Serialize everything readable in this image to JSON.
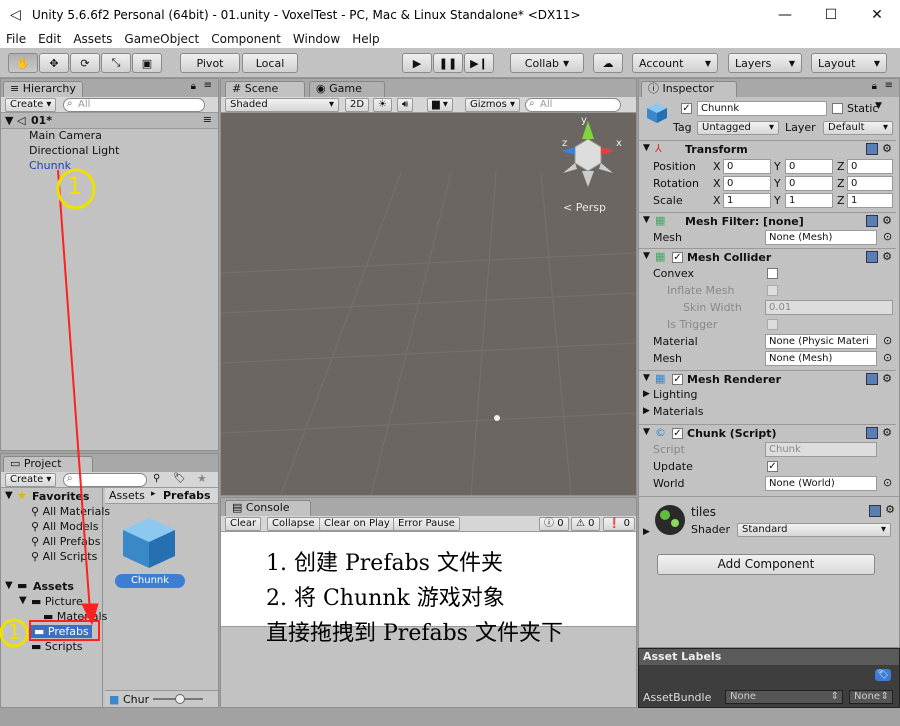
{
  "window": {
    "title": "Unity 5.6.6f2 Personal (64bit) - 01.unity - VoxelTest - PC, Mac & Linux Standalone* <DX11>",
    "minimize": "—",
    "maximize": "☐",
    "close": "✕"
  },
  "menu": [
    "File",
    "Edit",
    "Assets",
    "GameObject",
    "Component",
    "Window",
    "Help"
  ],
  "toolbar": {
    "pivot": "Pivot",
    "local": "Local",
    "collab": "Collab",
    "account": "Account",
    "layers": "Layers",
    "layout": "Layout"
  },
  "hierarchy": {
    "tab": "Hierarchy",
    "create": "Create",
    "search_placeholder": "All",
    "scene": "01*",
    "items": [
      "Main Camera",
      "Directional Light",
      "Chunnk"
    ]
  },
  "scene": {
    "tab_scene": "Scene",
    "tab_game": "Game",
    "shading": "Shaded",
    "mode2d": "2D",
    "gizmos": "Gizmos",
    "search_placeholder": "All",
    "persp": "Persp",
    "gizmo_axes": [
      "y",
      "x",
      "z"
    ]
  },
  "project": {
    "tab": "Project",
    "create": "Create",
    "fav_header": "Favorites",
    "favorites": [
      "All Materials",
      "All Models",
      "All Prefabs",
      "All Scripts"
    ],
    "assets_header": "Assets",
    "folders": [
      "Picture",
      "Materials",
      "Prefabs",
      "Scripts"
    ],
    "breadcrumb_root": "Assets",
    "breadcrumb_sep": "▸",
    "breadcrumb_leaf": "Prefabs",
    "asset_name": "Chunnk",
    "bottom_label": "Chur"
  },
  "console": {
    "tab": "Console",
    "buttons": [
      "Clear",
      "Collapse",
      "Clear on Play",
      "Error Pause"
    ],
    "counts": [
      "0",
      "0",
      "0"
    ]
  },
  "annotation": {
    "lines": [
      "1. 创建 Prefabs 文件夹",
      "2. 将 Chunnk 游戏对象",
      "直接拖拽到 Prefabs 文件夹下"
    ],
    "mark1": "1",
    "mark2": "1"
  },
  "inspector": {
    "tab": "Inspector",
    "object_name": "Chunnk",
    "static_label": "Static",
    "tag_label": "Tag",
    "tag_value": "Untagged",
    "layer_label": "Layer",
    "layer_value": "Default",
    "transform": {
      "title": "Transform",
      "rows": [
        {
          "label": "Position",
          "x": "0",
          "y": "0",
          "z": "0"
        },
        {
          "label": "Rotation",
          "x": "0",
          "y": "0",
          "z": "0"
        },
        {
          "label": "Scale",
          "x": "1",
          "y": "1",
          "z": "1"
        }
      ]
    },
    "axis_x": "X",
    "axis_y": "Y",
    "axis_z": "Z",
    "mesh_filter": {
      "title": "Mesh Filter: [none]",
      "mesh_label": "Mesh",
      "mesh_value": "None (Mesh)"
    },
    "mesh_collider": {
      "title": "Mesh Collider",
      "convex": "Convex",
      "inflate": "Inflate Mesh",
      "skin_width": "Skin Width",
      "skin_value": "0.01",
      "trigger": "Is Trigger",
      "material_label": "Material",
      "material_value": "None (Physic Materi",
      "mesh_label": "Mesh",
      "mesh_value": "None (Mesh)"
    },
    "mesh_renderer": {
      "title": "Mesh Renderer",
      "lighting": "Lighting",
      "materials": "Materials"
    },
    "chunk_script": {
      "title": "Chunk (Script)",
      "script_label": "Script",
      "script_value": "Chunk",
      "update_label": "Update",
      "world_label": "World",
      "world_value": "None (World)"
    },
    "material": {
      "name": "tiles",
      "shader_label": "Shader",
      "shader_value": "Standard"
    },
    "add_component": "Add Component",
    "asset_labels": "Asset Labels",
    "asset_bundle": "AssetBundle",
    "bundle_value": "None",
    "bundle_variant": "None"
  }
}
